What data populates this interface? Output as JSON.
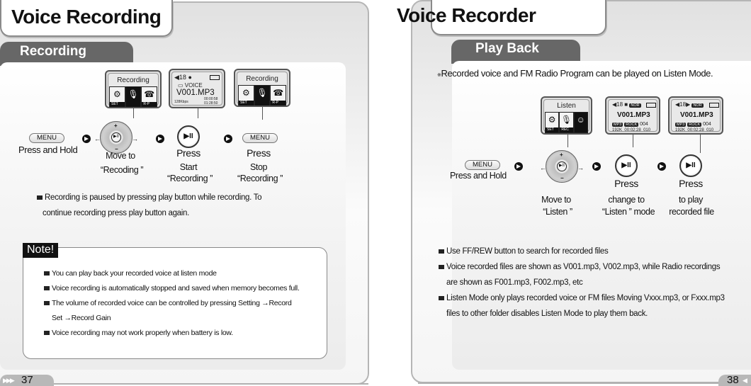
{
  "left_page": {
    "title": "Voice Recording",
    "section": "Recording",
    "steps": [
      {
        "button": "MENU",
        "caption": "Press and Hold"
      },
      {
        "caption_line1": "Move to",
        "caption_line2": "“Recoding ”"
      },
      {
        "caption_line1": "Press",
        "caption_line2": "Start",
        "caption_line3": "“Recording ”"
      },
      {
        "button": "MENU",
        "caption_line1": "Press",
        "caption_line2": "Stop",
        "caption_line3": "“Recording ”"
      }
    ],
    "screens": [
      {
        "title": "Recording",
        "icons": [
          {
            "name": "settings",
            "cap": "SET"
          },
          {
            "name": "microphone",
            "cap": ""
          },
          {
            "name": "radio",
            "cap": "R-P"
          }
        ]
      },
      {
        "volume": "18",
        "folder": "VOICE",
        "file": "V001.MP3",
        "bitrate": "128Kbps",
        "elapsed": "00:00:58",
        "remaining": "01:28:50"
      },
      {
        "title": "Recording",
        "icons": [
          {
            "name": "settings",
            "cap": "SET"
          },
          {
            "name": "microphone",
            "cap": ""
          },
          {
            "name": "radio",
            "cap": "R-P"
          }
        ]
      }
    ],
    "pause_note_line1": "Recording is paused by pressing play button while recording. To",
    "pause_note_line2": "continue recording press play button again.",
    "note_label": "Note!",
    "notes": [
      "You can play back your recorded voice at listen mode",
      "Voice recording is automatically stopped and saved when memory becomes full.",
      "The volume of recorded voice can be controlled by pressing Setting →Record",
      "Set →Record Gain",
      "Voice recording may not work properly when battery is low."
    ],
    "page_number": "37"
  },
  "right_page": {
    "title": "Voice Recorder",
    "section": "Play Back",
    "intro": "Recorded voice and FM Radio Program can be played on Listen Mode.",
    "intro_symbol": "※",
    "steps": [
      {
        "button": "MENU",
        "caption": "Press and Hold"
      },
      {
        "caption_line1": "Move to",
        "caption_line2": "“Listen ”"
      },
      {
        "caption_line1": "Press",
        "caption_line2": "change to",
        "caption_line3": "“Listen ” mode"
      },
      {
        "caption_line1": "Press",
        "caption_line2": "to play",
        "caption_line3": "recorded file"
      }
    ],
    "screens": [
      {
        "title": "Listen",
        "icons": [
          {
            "name": "settings",
            "cap": "SET"
          },
          {
            "name": "microphone",
            "cap": "REC"
          },
          {
            "name": "headphones-character",
            "cap": ""
          }
        ]
      },
      {
        "volume": "18",
        "state": "stop",
        "eq": "NOR",
        "file": "V001.MP3",
        "format": "MP3",
        "genre": "ROCK",
        "track": "004",
        "bitrate": "192K",
        "time": "00:02:28",
        "total": "010"
      },
      {
        "volume": "18",
        "state": "play",
        "eq": "NOR",
        "file": "V001.MP3",
        "format": "MP3",
        "genre": "ROCK",
        "track": "004",
        "bitrate": "192K",
        "time": "00:02:28",
        "total": "010"
      }
    ],
    "bullets": [
      "Use FF/REW button to search for recorded files",
      "Voice recorded files are shown as V001.mp3, V002.mp3,  while Radio recordings",
      "are shown as F001.mp3, F002.mp3, etc",
      "Listen Mode only plays recorded voice or FM files Moving Vxxx.mp3, or Fxxx.mp3",
      "files to other folder disables Listen Mode to play them back."
    ],
    "page_number": "38"
  },
  "glyphs": {
    "play_pause": "▶II",
    "plus": "+",
    "minus": "−",
    "left_arrow": "←",
    "right_arrow": "→",
    "speaker": "◀",
    "record_dot": "●",
    "folder": "▭",
    "play": "▶"
  }
}
